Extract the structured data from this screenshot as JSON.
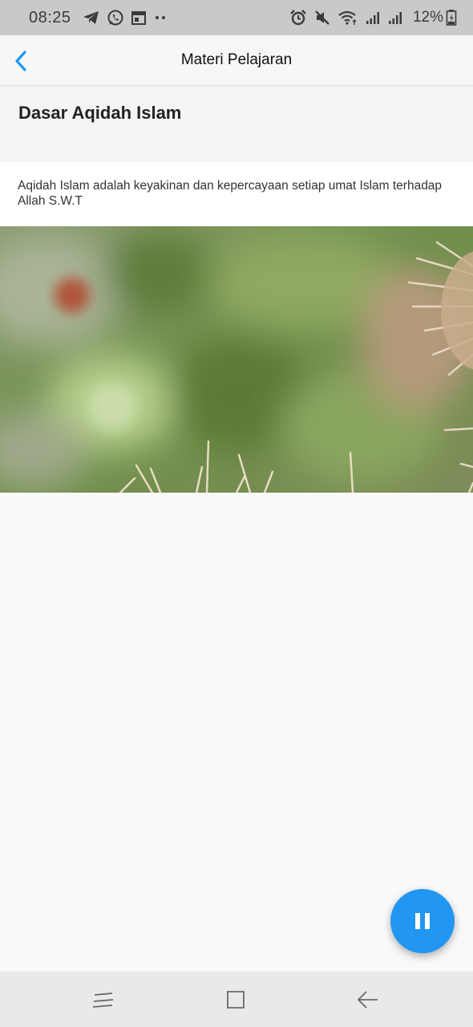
{
  "status_bar": {
    "time": "08:25",
    "left_icons": [
      "telegram-icon",
      "whatsapp-icon",
      "calendar-icon",
      "more-notifications-icon"
    ],
    "right_icons": [
      "alarm-icon",
      "mute-icon",
      "wifi-icon",
      "signal-icon",
      "signal-icon"
    ],
    "battery_percent": "12%"
  },
  "app_bar": {
    "title": "Materi Pelajaran",
    "back_icon": "chevron-left-icon",
    "accent_color": "#2196f3"
  },
  "lesson": {
    "title": "Dasar Aqidah Islam",
    "description": "Aqidah Islam adalah keyakinan dan kepercayaan setiap umat Islam terhadap Allah S.W.T"
  },
  "player": {
    "fab_icon": "pause-icon",
    "fab_color": "#2196f3"
  },
  "nav_bar": {
    "buttons": [
      "recent-apps-icon",
      "home-icon",
      "back-icon"
    ]
  }
}
